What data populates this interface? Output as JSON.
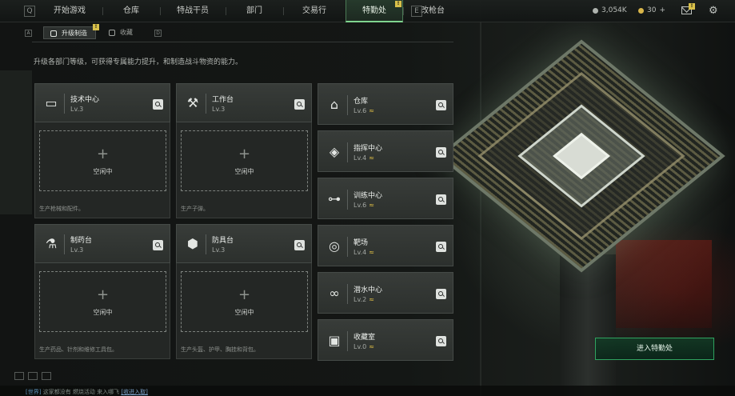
{
  "nav": {
    "left_key": "Q",
    "right_key": "E",
    "tabs": [
      {
        "label": "开始游戏"
      },
      {
        "label": "仓库"
      },
      {
        "label": "特战干员"
      },
      {
        "label": "部门"
      },
      {
        "label": "交易行"
      },
      {
        "label": "特勤处",
        "active": true,
        "badge": "!"
      },
      {
        "label": "改枪台"
      }
    ]
  },
  "currency": {
    "silver": "3,054K",
    "gold": "30",
    "gold_plus": "+"
  },
  "mail_badge": "!",
  "subtabs": {
    "left_key": "A",
    "right_key": "D",
    "items": [
      {
        "label": "升级制造",
        "active": true,
        "badge": "!"
      },
      {
        "label": "收藏"
      }
    ]
  },
  "description": "升级各部门等级，可获得专属能力提升，和制造战斗物资的能力。",
  "production": [
    {
      "name": "技术中心",
      "level": "Lv.3",
      "icon": "monitor-icon",
      "slot_status": "空闲中",
      "slot_plus": "+",
      "note": "生产枪械和配件。"
    },
    {
      "name": "工作台",
      "level": "Lv.3",
      "icon": "tools-icon",
      "slot_status": "空闲中",
      "slot_plus": "+",
      "note": "生产子弹。"
    },
    {
      "name": "制药台",
      "level": "Lv.3",
      "icon": "microscope-icon",
      "slot_status": "空闲中",
      "slot_plus": "+",
      "note": "生产药品、针剂和维修工具包。"
    },
    {
      "name": "防具台",
      "level": "Lv.3",
      "icon": "armor-parts-icon",
      "slot_status": "空闲中",
      "slot_plus": "+",
      "note": "生产头盔、护甲、胸挂和背包。"
    }
  ],
  "facilities": [
    {
      "name": "仓库",
      "level": "Lv.6",
      "icon": "warehouse-icon",
      "upgrade": "≈"
    },
    {
      "name": "指挥中心",
      "level": "Lv.4",
      "icon": "command-center-icon",
      "upgrade": "≈"
    },
    {
      "name": "训练中心",
      "level": "Lv.6",
      "icon": "dumbbell-icon",
      "upgrade": "≈"
    },
    {
      "name": "靶场",
      "level": "Lv.4",
      "icon": "target-icon",
      "upgrade": "≈"
    },
    {
      "name": "潜水中心",
      "level": "Lv.2",
      "icon": "diving-goggles-icon",
      "upgrade": "≈"
    },
    {
      "name": "收藏室",
      "level": "Lv.0",
      "icon": "collection-icon",
      "upgrade": "≈"
    }
  ],
  "enter_button": "进入特勤处",
  "chat": {
    "channel": "[世界]",
    "message": "这家都没有  燃烧活动 来入哪飞",
    "link": "[收进入取]"
  },
  "colors": {
    "accent_green": "#7fd48f",
    "badge_yellow": "#d8c04a",
    "upgrade_gold": "#e0bf46"
  }
}
